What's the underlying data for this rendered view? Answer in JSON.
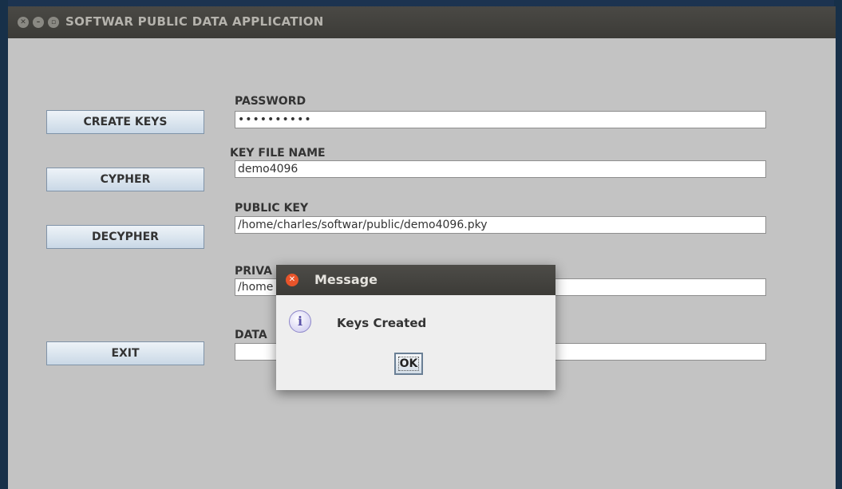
{
  "window": {
    "title": "SOFTWAR PUBLIC DATA APPLICATION"
  },
  "buttons": {
    "create_keys": "CREATE KEYS",
    "cypher": "CYPHER",
    "decypher": "DECYPHER",
    "exit": "EXIT"
  },
  "fields": {
    "password_label": "PASSWORD",
    "password_value": "••••••••••",
    "key_file_label": "KEY FILE NAME",
    "key_file_value": "demo4096",
    "public_key_label": "PUBLIC KEY",
    "public_key_value": "/home/charles/softwar/public/demo4096.pky",
    "private_key_label": "PRIVA",
    "private_key_value": "/home",
    "data_label": "DATA",
    "data_value": ""
  },
  "dialog": {
    "title": "Message",
    "message": "Keys Created",
    "ok_label": "OK"
  },
  "icons": {
    "close": "close-icon",
    "minimize": "minimize-icon",
    "maximize": "maximize-icon",
    "info": "info-icon"
  }
}
